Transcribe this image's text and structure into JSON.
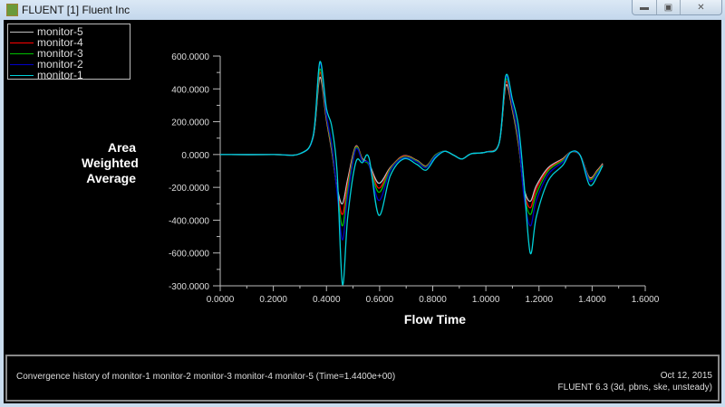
{
  "window": {
    "title": "FLUENT [1] Fluent Inc",
    "controls": [
      "minimize",
      "maximize",
      "close"
    ]
  },
  "footer": {
    "convergence": "Convergence history of monitor-1 monitor-2 monitor-3 monitor-4 monitor-5  (Time=1.4400e+00)",
    "date": "Oct 12, 2015",
    "version": "FLUENT 6.3 (3d, pbns, ske, unsteady)"
  },
  "chart_data": {
    "type": "line",
    "xlabel": "Flow Time",
    "ylabel": [
      "Area",
      "Weighted",
      "Average"
    ],
    "xlim": [
      0,
      1.6
    ],
    "ylim": [
      -800,
      600
    ],
    "xticks": [
      "0.0000",
      "0.2000",
      "0.4000",
      "0.6000",
      "0.8000",
      "1.0000",
      "1.2000",
      "1.4000",
      "1.6000"
    ],
    "yticks": [
      "600.0000",
      "400.0000",
      "200.0000",
      "0.0000",
      "-200.0000",
      "-400.0000",
      "-600.0000",
      "-300.0000"
    ],
    "legend_placement": "top-left",
    "x": [
      0,
      0.2,
      0.3,
      0.35,
      0.375,
      0.4,
      0.42,
      0.44,
      0.46,
      0.48,
      0.51,
      0.535,
      0.56,
      0.597,
      0.64,
      0.69,
      0.74,
      0.775,
      0.81,
      0.845,
      0.88,
      0.91,
      0.945,
      1.0,
      1.05,
      1.075,
      1.1,
      1.123,
      1.143,
      1.167,
      1.19,
      1.235,
      1.29,
      1.32,
      1.355,
      1.39,
      1.42,
      1.44
    ],
    "series": [
      {
        "name": "monitor-5",
        "color": "#c0c0c0",
        "values": [
          0,
          0,
          5,
          105,
          470,
          210,
          20,
          -200,
          -300,
          -150,
          50,
          -25,
          -55,
          -175,
          -80,
          -8,
          -35,
          -70,
          -3,
          20,
          -5,
          -27,
          5,
          15,
          70,
          420,
          270,
          60,
          -200,
          -285,
          -190,
          -80,
          -25,
          15,
          -5,
          -140,
          -95,
          -55
        ]
      },
      {
        "name": "monitor-4",
        "color": "#ff0000",
        "values": [
          0,
          0,
          5,
          108,
          500,
          220,
          30,
          -210,
          -365,
          -180,
          45,
          -30,
          -60,
          -205,
          -85,
          -10,
          -38,
          -72,
          -5,
          20,
          -5,
          -27,
          5,
          15,
          70,
          440,
          280,
          70,
          -215,
          -325,
          -210,
          -90,
          -30,
          15,
          -5,
          -145,
          -100,
          -60
        ]
      },
      {
        "name": "monitor-3",
        "color": "#00c000",
        "values": [
          0,
          0,
          5,
          110,
          520,
          230,
          40,
          -220,
          -435,
          -210,
          40,
          -35,
          -65,
          -230,
          -90,
          -15,
          -40,
          -75,
          -5,
          20,
          -5,
          -27,
          5,
          15,
          70,
          455,
          290,
          80,
          -230,
          -365,
          -240,
          -100,
          -35,
          15,
          -5,
          -150,
          -105,
          -65
        ]
      },
      {
        "name": "monitor-2",
        "color": "#0000c8",
        "values": [
          0,
          0,
          5,
          110,
          555,
          240,
          60,
          -230,
          -520,
          -250,
          30,
          -40,
          -60,
          -280,
          -100,
          -20,
          -45,
          -80,
          -10,
          20,
          -5,
          -27,
          5,
          15,
          70,
          470,
          300,
          100,
          -250,
          -435,
          -280,
          -120,
          -45,
          15,
          -5,
          -160,
          -115,
          -70
        ]
      },
      {
        "name": "monitor-1",
        "color": "#00d0d8",
        "values": [
          0,
          0,
          5,
          115,
          565,
          280,
          170,
          -105,
          -790,
          -380,
          -50,
          -50,
          -20,
          -370,
          -130,
          -27,
          -60,
          -95,
          -20,
          20,
          -5,
          -27,
          5,
          15,
          70,
          480,
          335,
          170,
          -160,
          -600,
          -380,
          -160,
          -65,
          15,
          -5,
          -185,
          -130,
          -65
        ]
      }
    ]
  }
}
